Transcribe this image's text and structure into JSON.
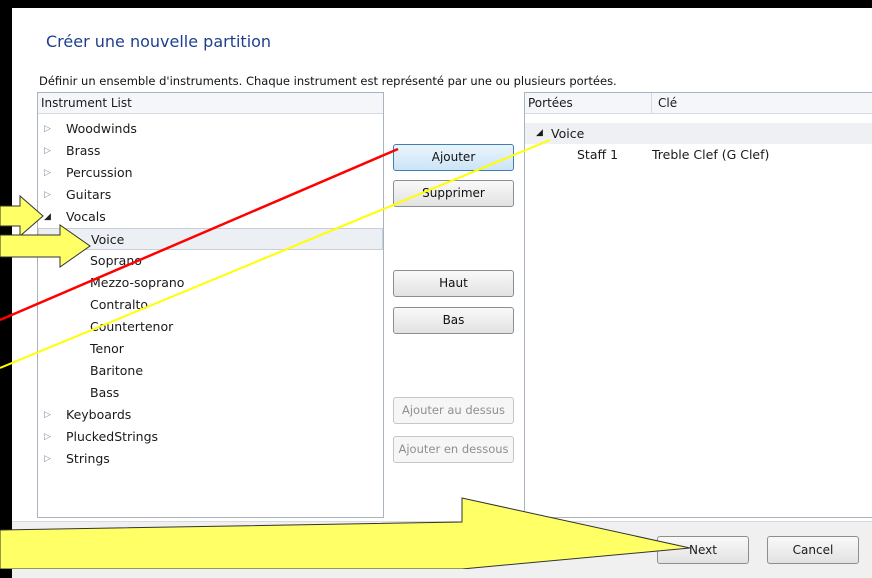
{
  "dialog": {
    "title": "Créer une nouvelle partition",
    "subtitle": "Définir un ensemble d'instruments. Chaque instrument est représenté par une ou plusieurs portées."
  },
  "instrument_list": {
    "header": "Instrument List",
    "items": [
      {
        "label": "Woodwinds",
        "expanded": false
      },
      {
        "label": "Brass",
        "expanded": false
      },
      {
        "label": "Percussion",
        "expanded": false
      },
      {
        "label": "Guitars",
        "expanded": false
      },
      {
        "label": "Vocals",
        "expanded": true
      },
      {
        "label": "Voice",
        "child": true,
        "selected": true
      },
      {
        "label": "Soprano",
        "child": true
      },
      {
        "label": "Mezzo-soprano",
        "child": true
      },
      {
        "label": "Contralto",
        "child": true
      },
      {
        "label": "Countertenor",
        "child": true
      },
      {
        "label": "Tenor",
        "child": true
      },
      {
        "label": "Baritone",
        "child": true
      },
      {
        "label": "Bass",
        "child": true
      },
      {
        "label": "Keyboards",
        "expanded": false
      },
      {
        "label": "PluckedStrings",
        "expanded": false
      },
      {
        "label": "Strings",
        "expanded": false
      }
    ]
  },
  "buttons": {
    "add": "Ajouter",
    "remove": "Supprimer",
    "up": "Haut",
    "down": "Bas",
    "add_above": "Ajouter au dessus",
    "add_below": "Ajouter en dessous"
  },
  "staves": {
    "col_staves": "Portées",
    "col_clef": "Clé",
    "group": "Voice",
    "rows": [
      {
        "staff": "Staff 1",
        "clef": "Treble Clef (G Clef)"
      }
    ]
  },
  "footer": {
    "next": "Next",
    "cancel": "Cancel"
  },
  "colors": {
    "title_blue": "#1e3f8f",
    "arrow_fill": "#ffff66",
    "red_line": "#ff0000",
    "yellow_line": "#ffff00"
  }
}
